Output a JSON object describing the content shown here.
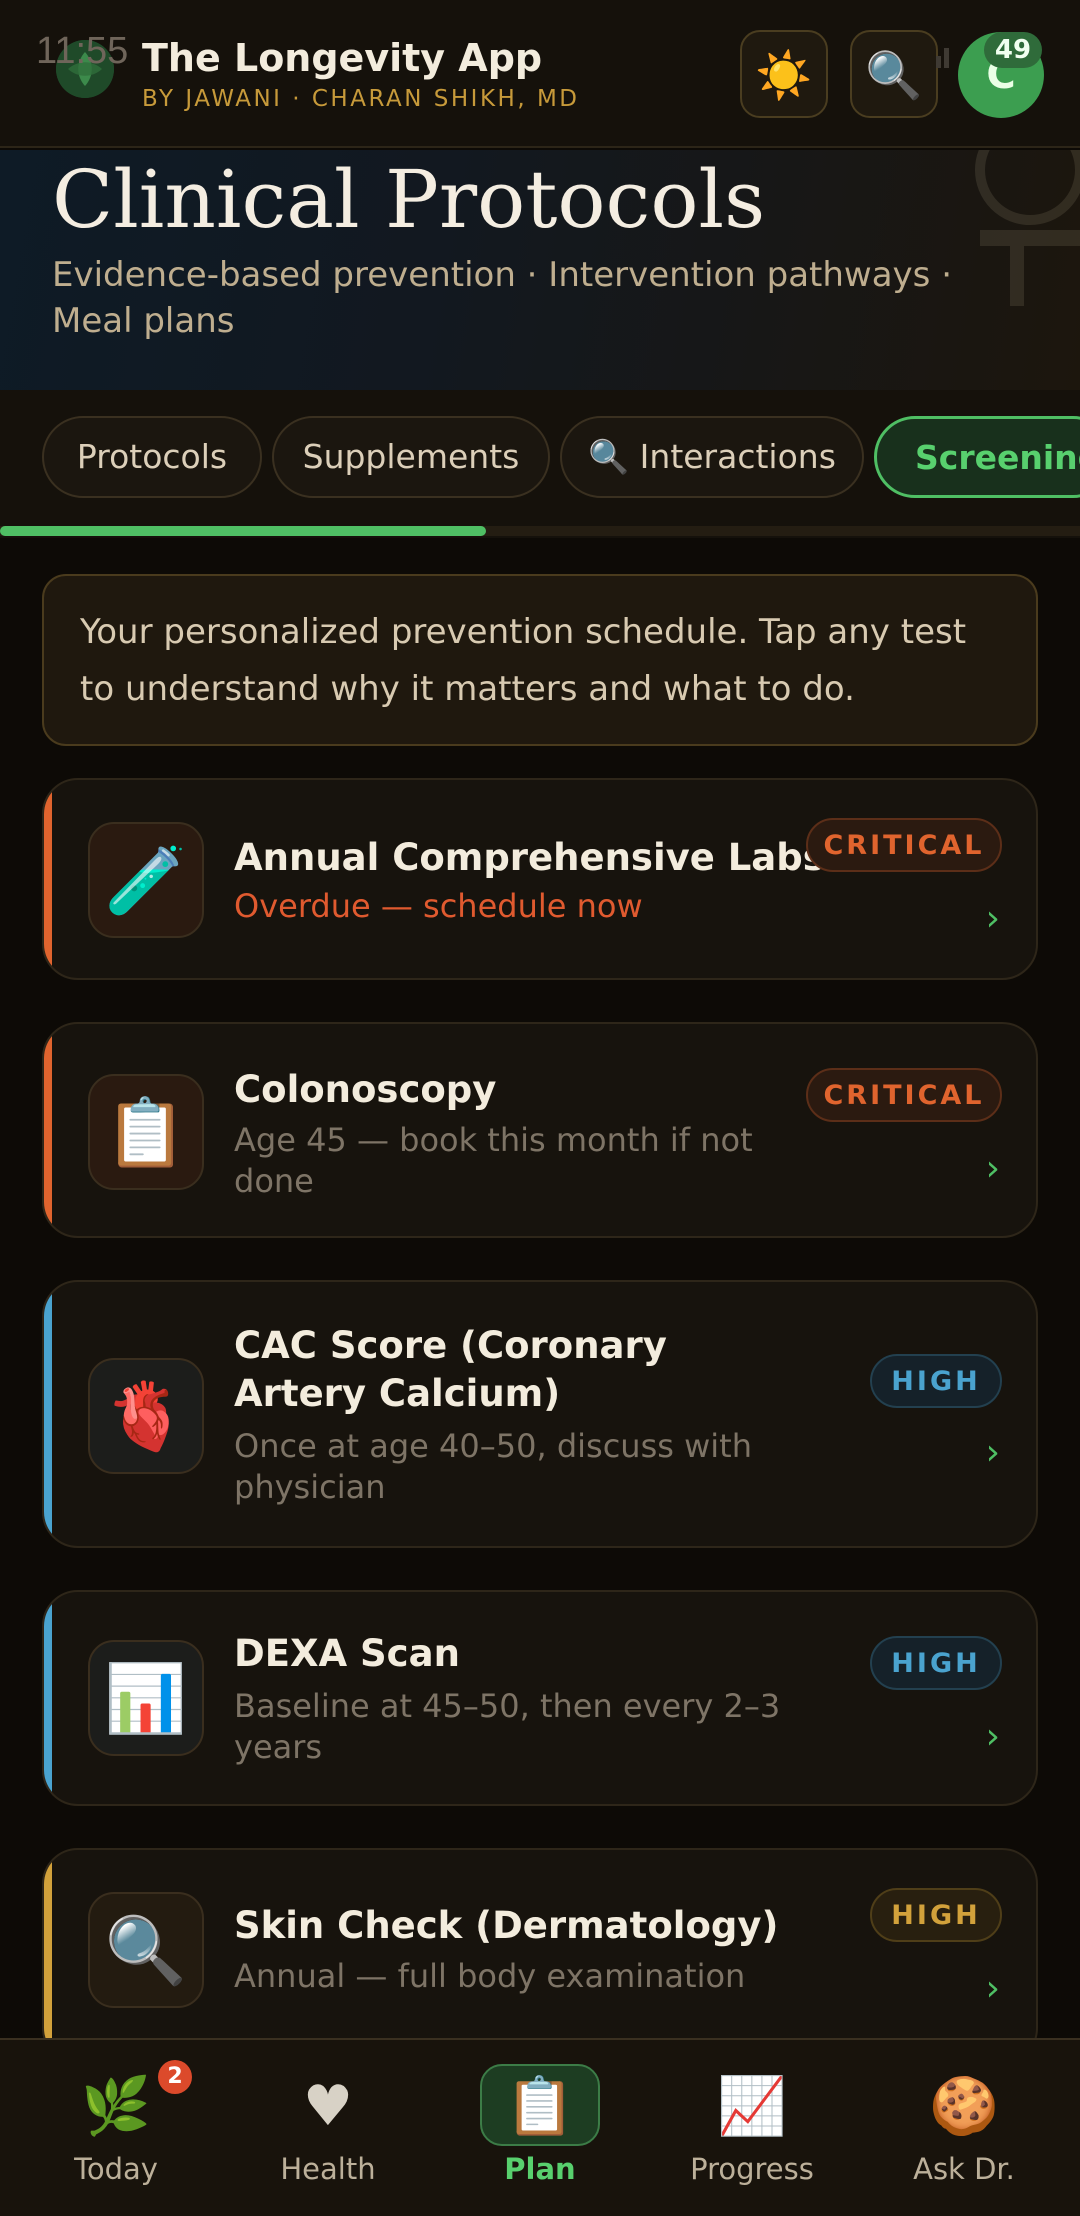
{
  "status": {
    "time": "11:55"
  },
  "header": {
    "title": "The Longevity App",
    "subtitle": "BY JAWANI · CHARAN SHIKH, MD",
    "sun_icon": "☀️",
    "search_icon": "🔍",
    "avatar_initial": "C",
    "avatar_badge": "49"
  },
  "hero": {
    "title": "Clinical Protocols",
    "subtitle": "Evidence-based prevention · Intervention pathways · Meal plans"
  },
  "tabs": [
    {
      "label": "Protocols"
    },
    {
      "label": "Supplements"
    },
    {
      "label": "🔍 Interactions"
    },
    {
      "label": "Screening",
      "active": true
    }
  ],
  "tab_scroll_progress": 0.45,
  "intro": "Your personalized prevention schedule. Tap any test to understand why it matters and what to do.",
  "screenings": [
    {
      "icon": "🧪",
      "title": "Annual Comprehensive Labs",
      "subtitle": "Overdue — schedule now",
      "priority": "CRITICAL",
      "chevron": "›"
    },
    {
      "icon": "📋",
      "title": "Colonoscopy",
      "subtitle": "Age 45 — book this month if not done",
      "priority": "CRITICAL",
      "chevron": "›"
    },
    {
      "icon": "🫀",
      "title": "CAC Score (Coronary Artery Calcium)",
      "subtitle": "Once at age 40–50, discuss with physician",
      "priority": "HIGH",
      "chevron": "›"
    },
    {
      "icon": "📊",
      "title": "DEXA Scan",
      "subtitle": "Baseline at 45–50, then every 2–3 years",
      "priority": "HIGH",
      "chevron": "›"
    },
    {
      "icon": "🔍",
      "title": "Skin Check (Dermatology)",
      "subtitle": "Annual — full body examination",
      "priority": "HIGH",
      "chevron": "›"
    }
  ],
  "colors": {
    "critical": "#e0642e",
    "high_blue": "#4aa3cf",
    "high_gold": "#d2a13b",
    "accent_green": "#4fbf64"
  },
  "nav": [
    {
      "icon": "🌿",
      "label": "Today",
      "badge": "2"
    },
    {
      "icon": "♥",
      "label": "Health"
    },
    {
      "icon": "📋",
      "label": "Plan",
      "active": true
    },
    {
      "icon": "📈",
      "label": "Progress"
    },
    {
      "icon": "🍪",
      "label": "Ask Dr."
    }
  ]
}
